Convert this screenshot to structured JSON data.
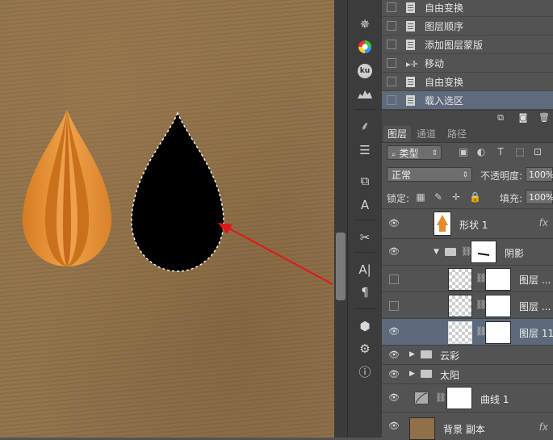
{
  "history": {
    "items": [
      {
        "label": "自由变换",
        "active": false
      },
      {
        "label": "图层顺序",
        "active": false
      },
      {
        "label": "添加图层蒙版",
        "active": false
      },
      {
        "label": "移动",
        "active": false
      },
      {
        "label": "自由变换",
        "active": false
      },
      {
        "label": "载入选区",
        "active": true
      }
    ]
  },
  "layers_panel": {
    "tabs": [
      "图层",
      "通道",
      "路径"
    ],
    "filter_kind": "类型",
    "blend_mode": "正常",
    "opacity_label": "不透明度:",
    "opacity_value": "100%",
    "lock_label": "锁定:",
    "fill_label": "填充:",
    "fill_value": "100%",
    "fx_label": "fx",
    "layers": [
      {
        "name": "形状 1",
        "fx": true
      },
      {
        "name": "阴影"
      },
      {
        "name": "图层 ..."
      },
      {
        "name": "图层 ..."
      },
      {
        "name": "图层 11"
      },
      {
        "name": "云彩"
      },
      {
        "name": "太阳"
      },
      {
        "name": "曲线 1"
      },
      {
        "name": "背景 副本",
        "fx": true
      }
    ]
  },
  "toolbar": {
    "icons": [
      "navigator-icon",
      "color-wheel-icon",
      "kuler-icon",
      "histogram-icon",
      "brush-presets-icon",
      "adjust-icon",
      "clone-source-icon",
      "character-icon",
      "tools-icon",
      "paragraph-char-icon",
      "paragraph-icon",
      "3d-icon",
      "properties-icon",
      "info-icon"
    ],
    "kuler_label": "ku"
  },
  "colors": {
    "canvas_bg": "#8f7048",
    "panel_bg": "#535353",
    "selected_row": "#5e6a7b",
    "arrow": "#e01818",
    "drop_orange": "#e48b2c"
  }
}
